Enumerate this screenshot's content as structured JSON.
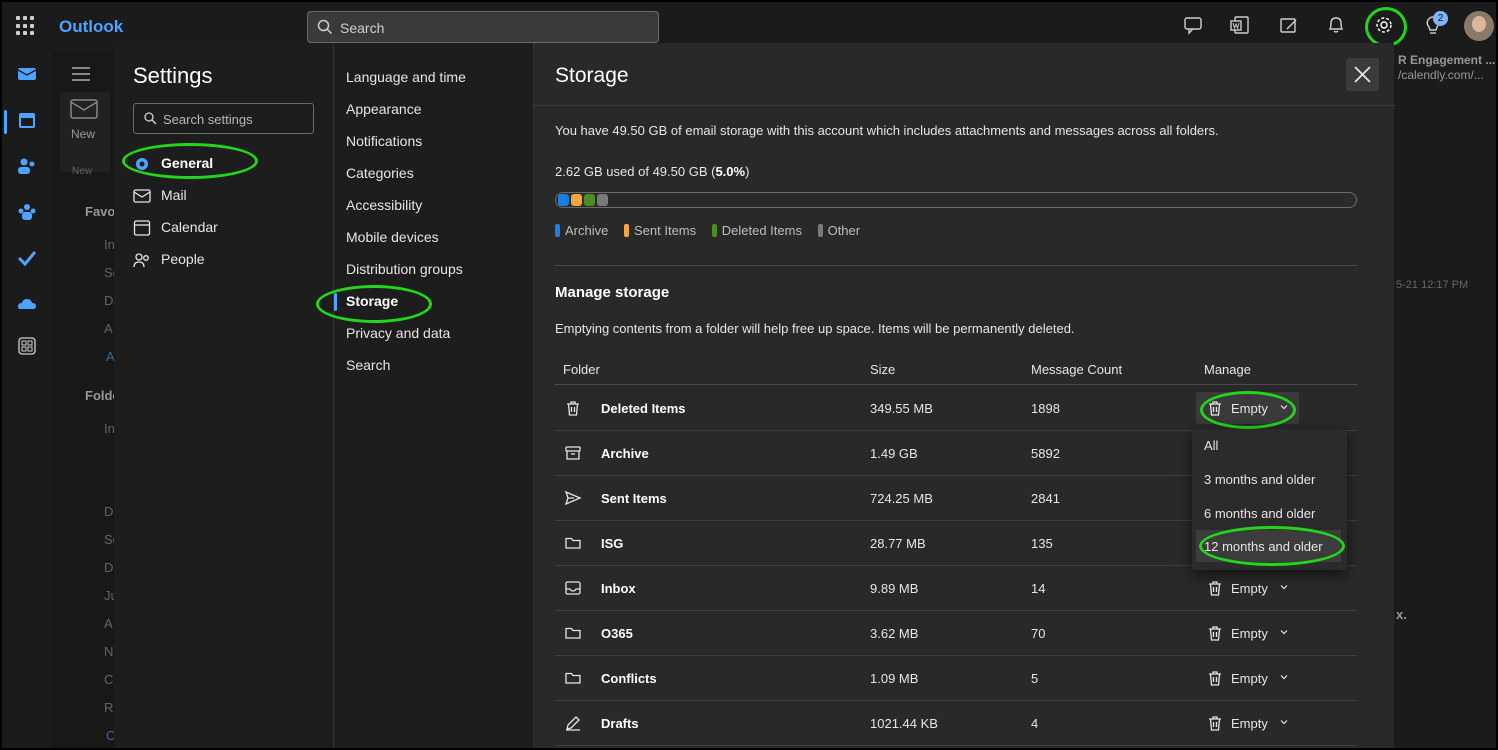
{
  "app": {
    "name": "Outlook",
    "search_placeholder": "Search",
    "notifications_badge": "2"
  },
  "background": {
    "new_button": "New",
    "new_group": "New",
    "favorites_label": "Favo",
    "folders_label": "Folde",
    "list_snippets": [
      "In",
      "Se",
      "D",
      "A",
      "A",
      "In",
      "D",
      "Se",
      "D",
      "Ju",
      "A",
      "N",
      "C",
      "R",
      "C"
    ],
    "reading_title": "R Engagement ...",
    "reading_link": "/calendly.com/...",
    "reading_time": "5-21 12:17 PM",
    "reading_tail": "x."
  },
  "settings": {
    "title": "Settings",
    "search_placeholder": "Search settings",
    "categories": [
      {
        "label": "General",
        "icon": "gear-icon"
      },
      {
        "label": "Mail",
        "icon": "mail-icon"
      },
      {
        "label": "Calendar",
        "icon": "calendar-icon"
      },
      {
        "label": "People",
        "icon": "people-icon"
      }
    ],
    "subcategories": [
      "Language and time",
      "Appearance",
      "Notifications",
      "Categories",
      "Accessibility",
      "Mobile devices",
      "Distribution groups",
      "Storage",
      "Privacy and data",
      "Search"
    ],
    "active_subcategory": "Storage"
  },
  "storage": {
    "title": "Storage",
    "intro": "You have 49.50 GB of email storage with this account which includes attachments and messages across all folders.",
    "used_prefix": "2.62 GB used of 49.50 GB (",
    "used_percent": "5.0%",
    "used_suffix": ")",
    "used_fraction": 0.05,
    "legend": [
      {
        "label": "Archive",
        "color": "#1a7fe0"
      },
      {
        "label": "Sent Items",
        "color": "#f7a53a"
      },
      {
        "label": "Deleted Items",
        "color": "#4a8f1f"
      },
      {
        "label": "Other",
        "color": "#7a7a7a"
      }
    ],
    "manage_title": "Manage storage",
    "manage_desc": "Emptying contents from a folder will help free up space. Items will be permanently deleted.",
    "columns": {
      "folder": "Folder",
      "size": "Size",
      "count": "Message Count",
      "manage": "Manage"
    },
    "empty_label": "Empty",
    "folders": [
      {
        "name": "Deleted Items",
        "size": "349.55 MB",
        "count": "1898",
        "icon": "trash-icon"
      },
      {
        "name": "Archive",
        "size": "1.49 GB",
        "count": "5892",
        "icon": "archive-icon"
      },
      {
        "name": "Sent Items",
        "size": "724.25 MB",
        "count": "2841",
        "icon": "send-icon"
      },
      {
        "name": "ISG",
        "size": "28.77 MB",
        "count": "135",
        "icon": "folder-icon"
      },
      {
        "name": "Inbox",
        "size": "9.89 MB",
        "count": "14",
        "icon": "inbox-icon"
      },
      {
        "name": "O365",
        "size": "3.62 MB",
        "count": "70",
        "icon": "folder-icon"
      },
      {
        "name": "Conflicts",
        "size": "1.09 MB",
        "count": "5",
        "icon": "folder-icon"
      },
      {
        "name": "Drafts",
        "size": "1021.44 KB",
        "count": "4",
        "icon": "pencil-icon"
      }
    ],
    "empty_menu": [
      "All",
      "3 months and older",
      "6 months and older",
      "12 months and older"
    ],
    "empty_menu_highlighted": "12 months and older"
  }
}
